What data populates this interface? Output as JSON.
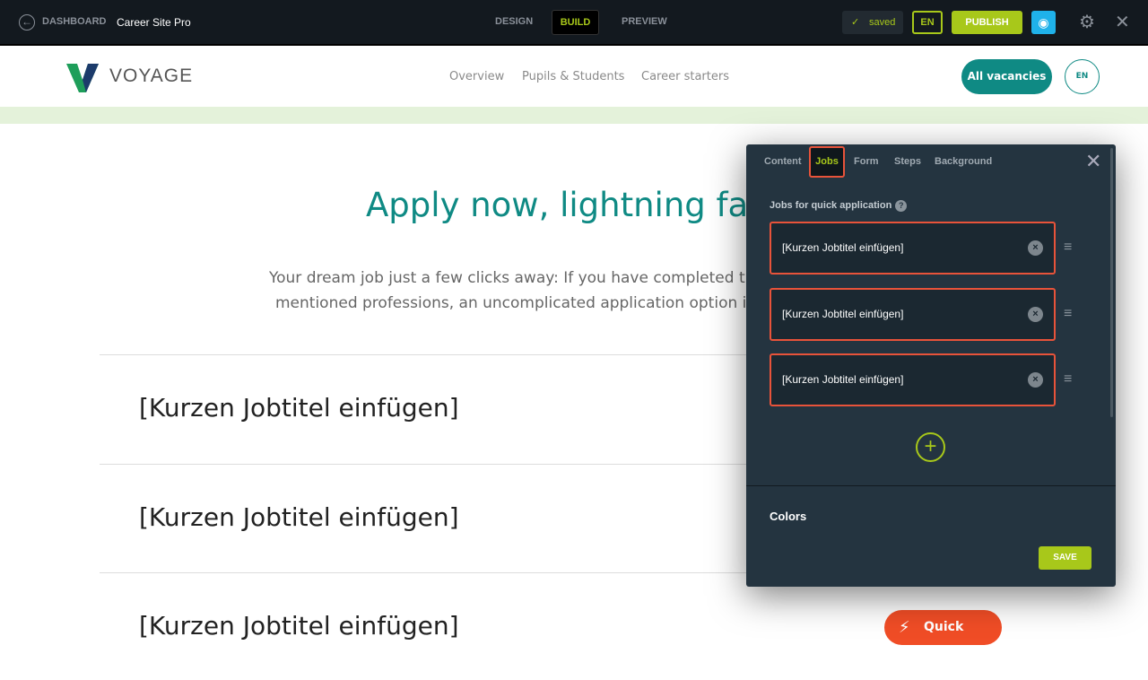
{
  "topbar": {
    "back_icon": "arrow-left-circle-icon",
    "dashboard": "DASHBOARD",
    "site_name": "Career Site Pro",
    "modes": [
      "DESIGN",
      "BUILD",
      "PREVIEW"
    ],
    "active_mode": "BUILD",
    "saved": "saved",
    "lang": "EN",
    "publish": "PUBLISH"
  },
  "header": {
    "logo": "VOYAGE",
    "nav": [
      "Overview",
      "Pupils & Students",
      "Career starters"
    ],
    "all_vacancies": "All vacancies",
    "lang": "EN"
  },
  "main": {
    "title": "Apply now, lightning fas",
    "subtitle_lines": [
      "Your dream job just a few clicks away: If you have completed trai",
      "mentioned professions, an uncomplicated application option is"
    ],
    "jobs": [
      "[Kurzen Jobtitel einfügen]",
      "[Kurzen Jobtitel einfügen]",
      "[Kurzen Jobtitel einfügen]"
    ],
    "quick_apply": "Quick apply"
  },
  "panel": {
    "tabs": [
      "Content",
      "Jobs",
      "Form",
      "Steps",
      "Background"
    ],
    "active_tab": "Jobs",
    "jobs_label": "Jobs for quick application",
    "help": "?",
    "job_inputs": [
      "[Kurzen Jobtitel einfügen]",
      "[Kurzen Jobtitel einfügen]",
      "[Kurzen Jobtitel einfügen]"
    ],
    "colors_heading": "Colors",
    "save": "SAVE"
  },
  "colors": {
    "accent": "#a8c81a",
    "brand": "#0f8a84",
    "danger": "#e8533a",
    "quick_apply": "#f04d26"
  }
}
